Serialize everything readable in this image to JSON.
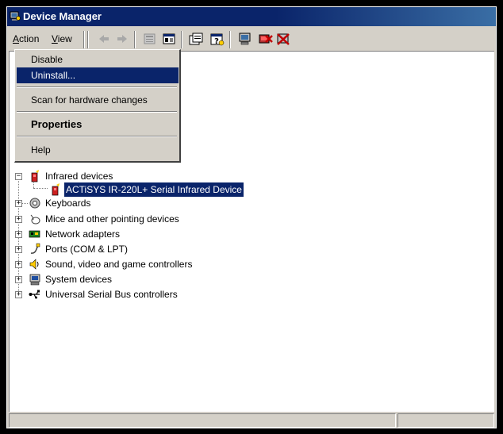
{
  "window": {
    "title": "Device Manager"
  },
  "menubar": {
    "action": {
      "underline": "A",
      "rest": "ction"
    },
    "view": {
      "underline": "V",
      "rest": "iew"
    }
  },
  "toolbar_icons": [
    "back-icon",
    "forward-icon",
    "up-icon",
    "show-hide-icon",
    "properties-icon",
    "help-icon",
    "scan-icon",
    "uninstall-icon",
    "disable-icon"
  ],
  "context_menu": {
    "items": [
      {
        "label": "Disable"
      },
      {
        "label": "Uninstall..."
      },
      {
        "label": "Scan for hardware changes"
      },
      {
        "label": "Properties"
      },
      {
        "label": "Help"
      }
    ],
    "highlighted": "Uninstall..."
  },
  "tree": {
    "infrared": "Infrared devices",
    "infrared_child": "ACTiSYS IR-220L+ Serial Infrared Device",
    "items": [
      {
        "label": "Keyboards",
        "icon": "keyboard-icon"
      },
      {
        "label": "Mice and other pointing devices",
        "icon": "mouse-icon"
      },
      {
        "label": "Network adapters",
        "icon": "network-adapter-icon"
      },
      {
        "label": "Ports (COM & LPT)",
        "icon": "port-icon"
      },
      {
        "label": "Sound, video and game controllers",
        "icon": "sound-icon"
      },
      {
        "label": "System devices",
        "icon": "computer-icon"
      },
      {
        "label": "Universal Serial Bus controllers",
        "icon": "usb-icon"
      }
    ]
  },
  "colors": {
    "titlebar": "#0a246a",
    "face": "#d4d0c8",
    "selection": "#0a246a"
  }
}
